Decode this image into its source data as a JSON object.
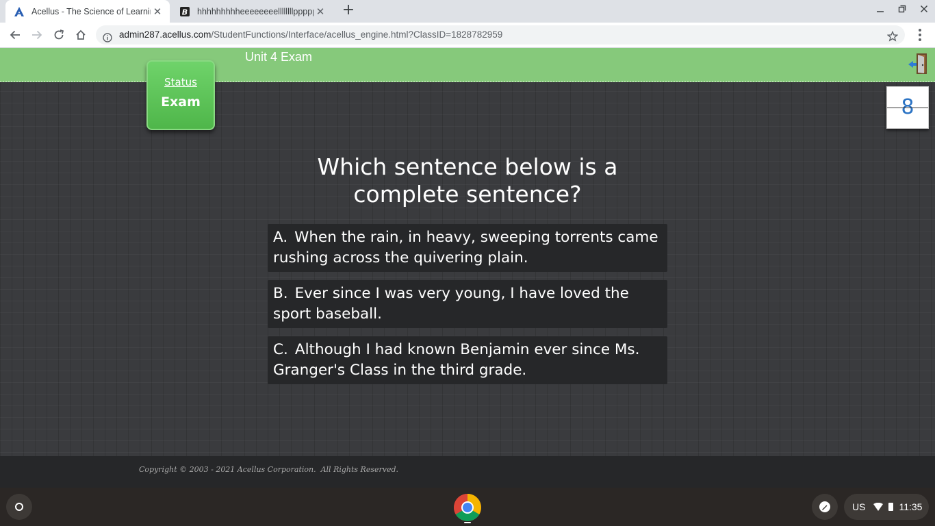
{
  "browser": {
    "tabs": [
      {
        "title": "Acellus - The Science of Learning",
        "favicon": "acellus-logo-icon",
        "active": true
      },
      {
        "title": "hhhhhhhhheeeeeeeellllllllpppppp",
        "favicon": "bold-b-icon",
        "active": false
      }
    ],
    "new_tab_label": "+",
    "address": {
      "host": "admin287.acellus.com",
      "path": "/StudentFunctions/Interface/acellus_engine.html?ClassID=1828782959"
    }
  },
  "app": {
    "exam_title": "Unit 4 Exam",
    "status_card": {
      "label": "Status",
      "value": "Exam"
    },
    "question_number": "8",
    "question": "Which sentence below is a complete sentence?",
    "answers": [
      {
        "letter": "A.",
        "text": "When the rain, in heavy, sweeping torrents came rushing across the quivering plain."
      },
      {
        "letter": "B.",
        "text": "Ever since I was very young, I have loved the sport baseball."
      },
      {
        "letter": "C.",
        "text": "Although I had known Benjamin ever since Ms. Granger's Class in the third grade."
      }
    ],
    "footer": {
      "copyright": "Copyright © 2003 - 2021 Acellus Corporation.  All Rights Reserved."
    },
    "colors": {
      "header_green": "#86c97b",
      "status_green": "#5cc456",
      "counter_blue": "#2b73c4"
    }
  },
  "os": {
    "keyboard_layout": "US",
    "time": "11:35",
    "shelf_apps": [
      "chrome-icon"
    ]
  }
}
